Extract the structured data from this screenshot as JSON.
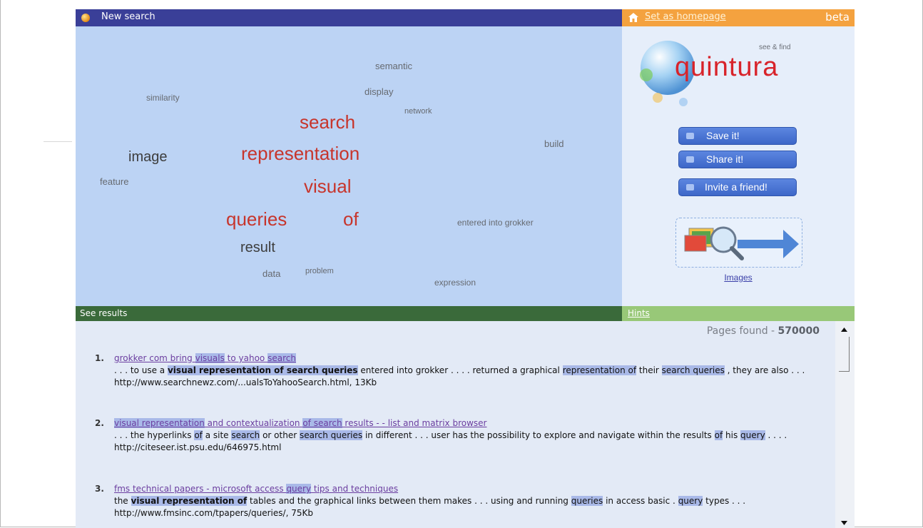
{
  "topbar": {
    "title": "New search",
    "homepage_link": "Set as homepage",
    "beta": "beta"
  },
  "tag_cloud": [
    {
      "text": "semantic",
      "weight": "small",
      "color": "grey"
    },
    {
      "text": "display",
      "weight": "small",
      "color": "grey"
    },
    {
      "text": "similarity",
      "weight": "small",
      "color": "grey"
    },
    {
      "text": "network",
      "weight": "tiny",
      "color": "grey"
    },
    {
      "text": "search",
      "weight": "large",
      "color": "red"
    },
    {
      "text": "build",
      "weight": "small",
      "color": "grey"
    },
    {
      "text": "image",
      "weight": "medium",
      "color": "dark"
    },
    {
      "text": "representation",
      "weight": "large",
      "color": "red"
    },
    {
      "text": "feature",
      "weight": "small",
      "color": "grey"
    },
    {
      "text": "visual",
      "weight": "large",
      "color": "red"
    },
    {
      "text": "queries",
      "weight": "large",
      "color": "red"
    },
    {
      "text": "of",
      "weight": "large",
      "color": "red"
    },
    {
      "text": "entered into grokker",
      "weight": "small",
      "color": "grey"
    },
    {
      "text": "result",
      "weight": "medium",
      "color": "dark"
    },
    {
      "text": "data",
      "weight": "small",
      "color": "grey"
    },
    {
      "text": "problem",
      "weight": "tiny",
      "color": "grey"
    },
    {
      "text": "expression",
      "weight": "small",
      "color": "grey"
    }
  ],
  "panel": {
    "logo_tagline": "see & find",
    "logo_text": "quintura",
    "buttons": {
      "save": "Save it!",
      "share": "Share it!",
      "invite": "Invite a friend!"
    },
    "images_link": "Images"
  },
  "bars": {
    "results": "See results",
    "hints": "Hints"
  },
  "results": {
    "pages_found_label": "Pages found - ",
    "pages_found_count": "570000",
    "items": [
      {
        "num": "1.",
        "title": [
          {
            "t": "grokker com bring "
          },
          {
            "t": "visuals",
            "h": "hl"
          },
          {
            "t": " to yahoo "
          },
          {
            "t": "search",
            "h": "hl"
          }
        ],
        "snippet": [
          {
            "t": ". . . to use a "
          },
          {
            "t": "visual representation of search queries",
            "h": "hlb"
          },
          {
            "t": " entered into grokker . . . . returned a graphical "
          },
          {
            "t": "representation of",
            "h": "hl"
          },
          {
            "t": " their "
          },
          {
            "t": "search queries",
            "h": "hl"
          },
          {
            "t": " , they are also . . ."
          }
        ],
        "url": "http://www.searchnewz.com/...ualsToYahooSearch.html, 13Kb"
      },
      {
        "num": "2.",
        "title": [
          {
            "t": "visual representation",
            "h": "hl"
          },
          {
            "t": " and contextualization "
          },
          {
            "t": "of search",
            "h": "hl"
          },
          {
            "t": " results - - list and matrix browser"
          }
        ],
        "snippet": [
          {
            "t": ". . . the hyperlinks "
          },
          {
            "t": "of",
            "h": "hl"
          },
          {
            "t": " a site "
          },
          {
            "t": "search",
            "h": "hl"
          },
          {
            "t": " or other "
          },
          {
            "t": "search queries",
            "h": "hl"
          },
          {
            "t": " in different . . . user has the possibility to explore and navigate within the results "
          },
          {
            "t": "of",
            "h": "hl"
          },
          {
            "t": " his "
          },
          {
            "t": "query",
            "h": "hl"
          },
          {
            "t": " . . . ."
          }
        ],
        "url": "http://citeseer.ist.psu.edu/646975.html"
      },
      {
        "num": "3.",
        "title": [
          {
            "t": "fms technical papers - microsoft access "
          },
          {
            "t": "query",
            "h": "hl"
          },
          {
            "t": " tips and techniques"
          }
        ],
        "snippet": [
          {
            "t": "the "
          },
          {
            "t": "visual representation of",
            "h": "hlb"
          },
          {
            "t": " tables and the graphical links between them makes . . . using and running "
          },
          {
            "t": "queries",
            "h": "hl"
          },
          {
            "t": " in access basic . "
          },
          {
            "t": "query",
            "h": "hl"
          },
          {
            "t": " types . . ."
          }
        ],
        "url": "http://www.fmsinc.com/tpapers/queries/, 75Kb"
      }
    ]
  }
}
